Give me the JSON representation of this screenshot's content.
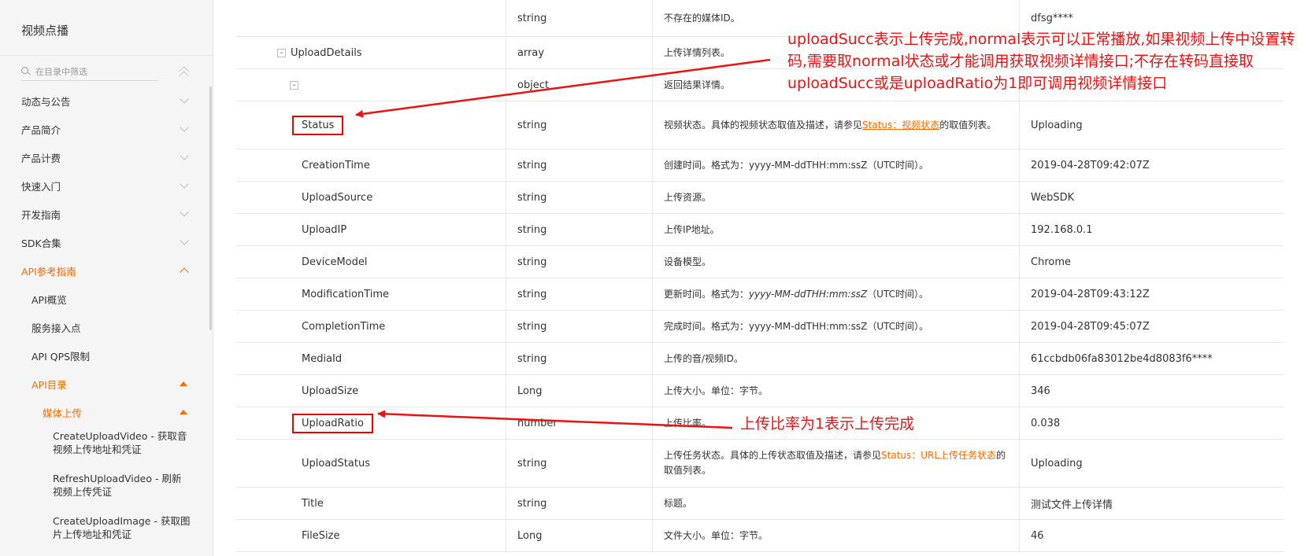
{
  "sidebar": {
    "title": "视频点播",
    "search_placeholder": "在目录中筛选",
    "items": [
      {
        "label": "动态与公告"
      },
      {
        "label": "产品简介"
      },
      {
        "label": "产品计费"
      },
      {
        "label": "快速入门"
      },
      {
        "label": "开发指南"
      },
      {
        "label": "SDK合集"
      },
      {
        "label": "API参考指南"
      },
      {
        "label": "API概览"
      },
      {
        "label": "服务接入点"
      },
      {
        "label": "API QPS限制"
      },
      {
        "label": "API目录"
      },
      {
        "label": "媒体上传"
      },
      {
        "label": "CreateUploadVideo - 获取音视频上传地址和凭证"
      },
      {
        "label": "RefreshUploadVideo - 刷新视频上传凭证"
      },
      {
        "label": "CreateUploadImage - 获取图片上传地址和凭证"
      }
    ]
  },
  "table": {
    "rows": [
      {
        "name": "",
        "type": "string",
        "desc": "不存在的媒体ID。",
        "example": "dfsg****"
      },
      {
        "name": "UploadDetails",
        "toggle": "-",
        "type": "array",
        "desc": "上传详情列表。",
        "example": ""
      },
      {
        "name": "",
        "toggle": "-",
        "type": "object",
        "desc": "返回结果详情。",
        "example": ""
      },
      {
        "name": "Status",
        "type": "string",
        "desc_pre": "视频状态。具体的视频状态取值及描述，请参见",
        "desc_link": "Status：视频状态",
        "desc_post": "的取值列表。",
        "example": "Uploading"
      },
      {
        "name": "CreationTime",
        "type": "string",
        "desc": "创建时间。格式为：yyyy-MM-ddTHH:mm:ssZ（UTC时间）。",
        "example": "2019-04-28T09:42:07Z"
      },
      {
        "name": "UploadSource",
        "type": "string",
        "desc": "上传资源。",
        "example": "WebSDK"
      },
      {
        "name": "UploadIP",
        "type": "string",
        "desc": "上传IP地址。",
        "example": "192.168.0.1"
      },
      {
        "name": "DeviceModel",
        "type": "string",
        "desc": "设备模型。",
        "example": "Chrome"
      },
      {
        "name": "ModificationTime",
        "type": "string",
        "desc_pre": "更新时间。格式为：",
        "desc_italic": "yyyy-MM-ddTHH:mm:ssZ",
        "desc_post": "（UTC时间）。",
        "example": "2019-04-28T09:43:12Z"
      },
      {
        "name": "CompletionTime",
        "type": "string",
        "desc": "完成时间。格式为：yyyy-MM-ddTHH:mm:ssZ（UTC时间）。",
        "example": "2019-04-28T09:45:07Z"
      },
      {
        "name": "MediaId",
        "type": "string",
        "desc": "上传的音/视频ID。",
        "example": "61ccbdb06fa83012be4d8083f6****"
      },
      {
        "name": "UploadSize",
        "type": "Long",
        "desc": "上传大小。单位：字节。",
        "example": "346"
      },
      {
        "name": "UploadRatio",
        "type": "number",
        "desc": "上传比率。",
        "example": "0.038"
      },
      {
        "name": "UploadStatus",
        "type": "string",
        "desc_pre": "上传任务状态。具体的上传状态取值及描述，请参见",
        "desc_link": "Status：URL上传任务状态",
        "desc_post": "的取值列表。",
        "example": "Uploading"
      },
      {
        "name": "Title",
        "type": "string",
        "desc": "标题。",
        "example": "测试文件上传详情"
      },
      {
        "name": "FileSize",
        "type": "Long",
        "desc": "文件大小。单位：字节。",
        "example": "46"
      }
    ]
  },
  "annotations": {
    "note1": "uploadSucc表示上传完成,normal表示可以正常播放,如果视频上传中设置转码,需要取normal状态或才能调用获取视频详情接口;不存在转码直接取uploadSucc或是uploadRatio为1即可调用视频详情接口",
    "note2": "上传比率为1表示上传完成"
  },
  "colors": {
    "accent": "#ff6a00",
    "annotation": "#ee1111"
  }
}
